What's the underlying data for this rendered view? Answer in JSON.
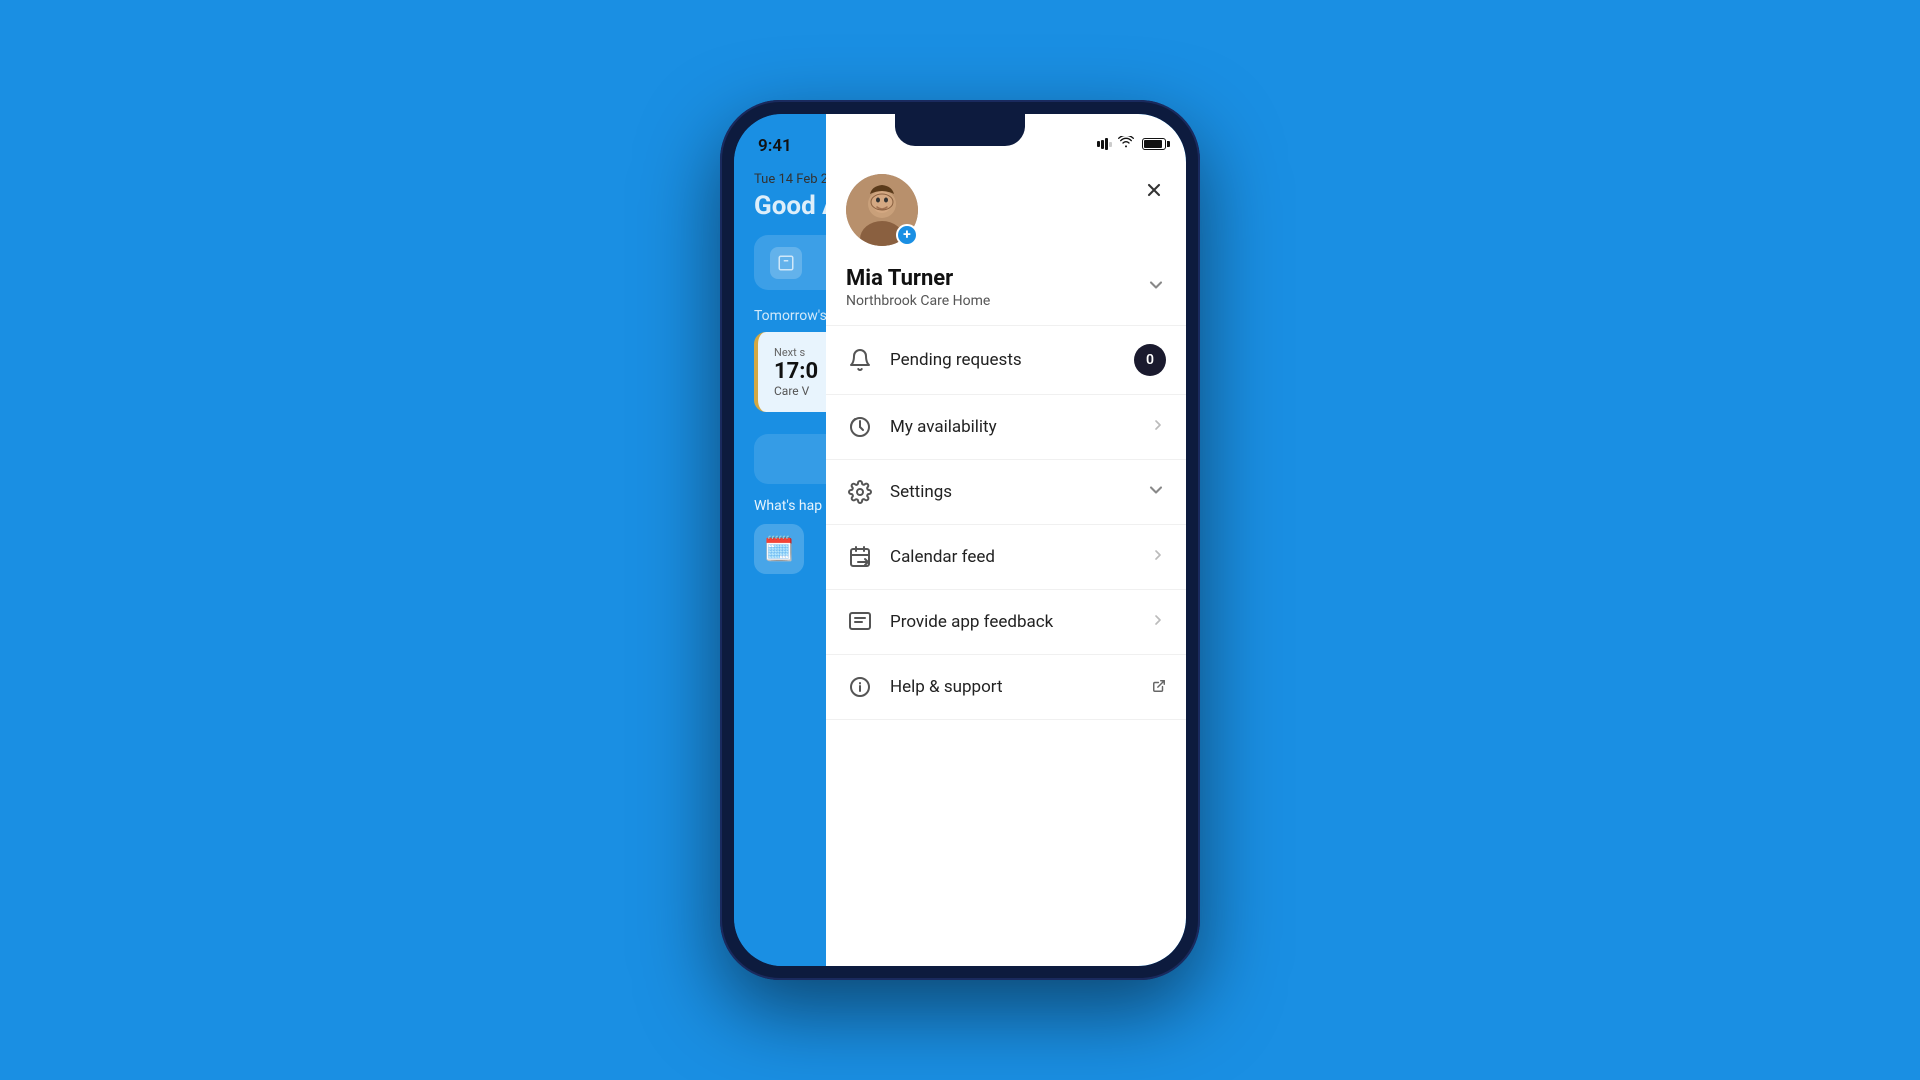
{
  "background_color": "#1a8fe3",
  "phone": {
    "status_bar": {
      "time": "9:41"
    },
    "bg_app": {
      "date": "Tue 14 Feb 2",
      "greeting": "Good A",
      "tomorrow_label": "Tomorrow's",
      "shift": {
        "next_label": "Next s",
        "time": "17:0",
        "desc": "Care V"
      },
      "whats_happening": "What's hap"
    },
    "panel": {
      "profile": {
        "name": "Mia Turner",
        "organization": "Northbrook Care Home",
        "add_photo_label": "+"
      },
      "close_label": "×",
      "menu_items": [
        {
          "id": "pending-requests",
          "label": "Pending requests",
          "icon": "bell",
          "badge": "0",
          "has_chevron": false,
          "has_badge": true
        },
        {
          "id": "my-availability",
          "label": "My availability",
          "icon": "clock",
          "has_chevron": true,
          "has_badge": false
        },
        {
          "id": "settings",
          "label": "Settings",
          "icon": "gear",
          "has_chevron_down": true,
          "has_badge": false
        },
        {
          "id": "calendar-feed",
          "label": "Calendar feed",
          "icon": "calendar-arrow",
          "has_chevron": true,
          "has_badge": false
        },
        {
          "id": "provide-app-feedback",
          "label": "Provide app feedback",
          "icon": "chat-lines",
          "has_chevron": true,
          "has_badge": false
        },
        {
          "id": "help-support",
          "label": "Help & support",
          "icon": "info-circle",
          "has_external": true,
          "has_badge": false
        }
      ]
    }
  }
}
